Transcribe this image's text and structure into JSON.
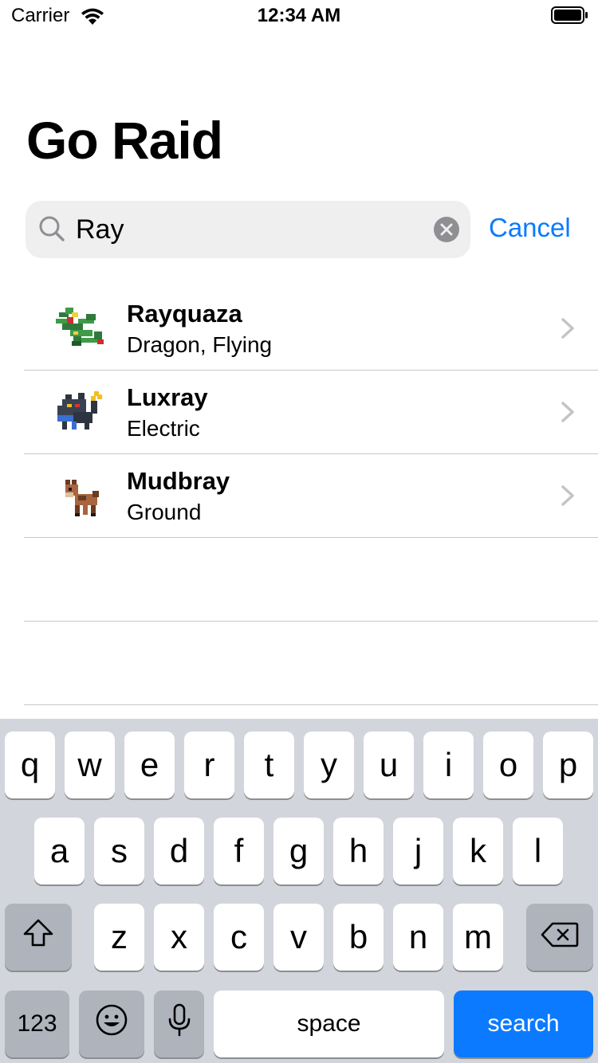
{
  "status_bar": {
    "carrier": "Carrier",
    "time": "12:34 AM"
  },
  "page_title": "Go Raid",
  "search": {
    "value": "Ray",
    "cancel_label": "Cancel"
  },
  "results": [
    {
      "name": "Rayquaza",
      "types": "Dragon, Flying",
      "sprite_icon": "rayquaza-sprite-icon"
    },
    {
      "name": "Luxray",
      "types": "Electric",
      "sprite_icon": "luxray-sprite-icon"
    },
    {
      "name": "Mudbray",
      "types": "Ground",
      "sprite_icon": "mudbray-sprite-icon"
    }
  ],
  "keyboard": {
    "row1": [
      "q",
      "w",
      "e",
      "r",
      "t",
      "y",
      "u",
      "i",
      "o",
      "p"
    ],
    "row2": [
      "a",
      "s",
      "d",
      "f",
      "g",
      "h",
      "j",
      "k",
      "l"
    ],
    "row3": [
      "z",
      "x",
      "c",
      "v",
      "b",
      "n",
      "m"
    ],
    "numbers_label": "123",
    "space_label": "space",
    "search_label": "search"
  },
  "colors": {
    "accent": "#0a7aff",
    "search_key": "#0b7aff",
    "keyboard_bg": "#d2d5db"
  }
}
